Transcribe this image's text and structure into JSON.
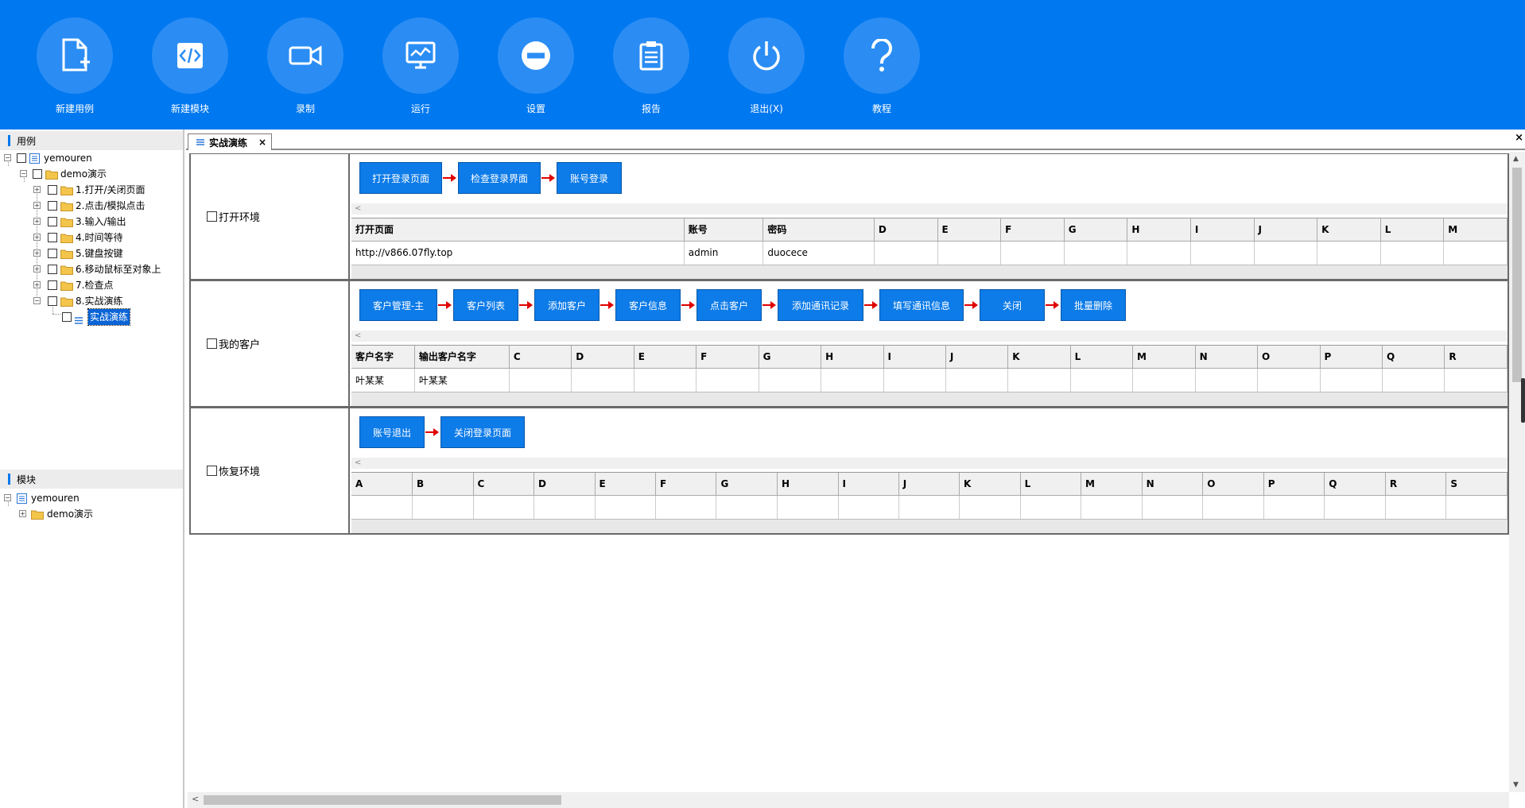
{
  "toolbar": {
    "buttons": [
      {
        "label": "新建用例",
        "icon": "new-file-icon"
      },
      {
        "label": "新建模块",
        "icon": "code-icon"
      },
      {
        "label": "录制",
        "icon": "video-icon"
      },
      {
        "label": "运行",
        "icon": "monitor-icon"
      },
      {
        "label": "设置",
        "icon": "minus-circle-icon"
      },
      {
        "label": "报告",
        "icon": "clipboard-icon"
      },
      {
        "label": "退出(X)",
        "icon": "power-icon"
      },
      {
        "label": "教程",
        "icon": "question-icon"
      }
    ]
  },
  "cases_panel": {
    "title": "用例",
    "root": "yemouren",
    "folder": "demo演示",
    "items": [
      "1.打开/关闭页面",
      "2.点击/模拟点击",
      "3.输入/输出",
      "4.时间等待",
      "5.键盘按键",
      "6.移动鼠标至对象上",
      "7.检查点",
      "8.实战演练"
    ],
    "selected_leaf": "实战演练"
  },
  "modules_panel": {
    "title": "模块",
    "root": "yemouren",
    "folder": "demo演示"
  },
  "tab": {
    "label": "实战演练",
    "close": "×"
  },
  "close_all": "×",
  "rows": [
    {
      "label": "打开环境",
      "steps": [
        "打开登录页面",
        "检查登录界面",
        "账号登录"
      ],
      "columns": [
        "打开页面",
        "账号",
        "密码",
        "D",
        "E",
        "F",
        "G",
        "H",
        "I",
        "J",
        "K",
        "L",
        "M"
      ],
      "values": [
        "http://v866.07fly.top",
        "admin",
        "duocece",
        "",
        "",
        "",
        "",
        "",
        "",
        "",
        "",
        "",
        ""
      ]
    },
    {
      "label": "我的客户",
      "steps": [
        "客户管理-主",
        "客户列表",
        "添加客户",
        "客户信息",
        "点击客户",
        "添加通讯记录",
        "填写通讯信息",
        "关闭",
        "批量删除"
      ],
      "columns": [
        "客户名字",
        "输出客户名字",
        "C",
        "D",
        "E",
        "F",
        "G",
        "H",
        "I",
        "J",
        "K",
        "L",
        "M",
        "N",
        "O",
        "P",
        "Q",
        "R"
      ],
      "values": [
        "叶某某",
        "叶某某",
        "",
        "",
        "",
        "",
        "",
        "",
        "",
        "",
        "",
        "",
        "",
        "",
        "",
        "",
        "",
        ""
      ]
    },
    {
      "label": "恢复环境",
      "steps": [
        "账号退出",
        "关闭登录页面"
      ],
      "columns": [
        "A",
        "B",
        "C",
        "D",
        "E",
        "F",
        "G",
        "H",
        "I",
        "J",
        "K",
        "L",
        "M",
        "N",
        "O",
        "P",
        "Q",
        "R",
        "S"
      ],
      "values": [
        "",
        "",
        "",
        "",
        "",
        "",
        "",
        "",
        "",
        "",
        "",
        "",
        "",
        "",
        "",
        "",
        "",
        "",
        ""
      ]
    }
  ],
  "scroll_left_glyph": "<",
  "colors": {
    "toolbar": "#0078f0",
    "step": "#0d7be8",
    "arrow": "#e00000"
  }
}
